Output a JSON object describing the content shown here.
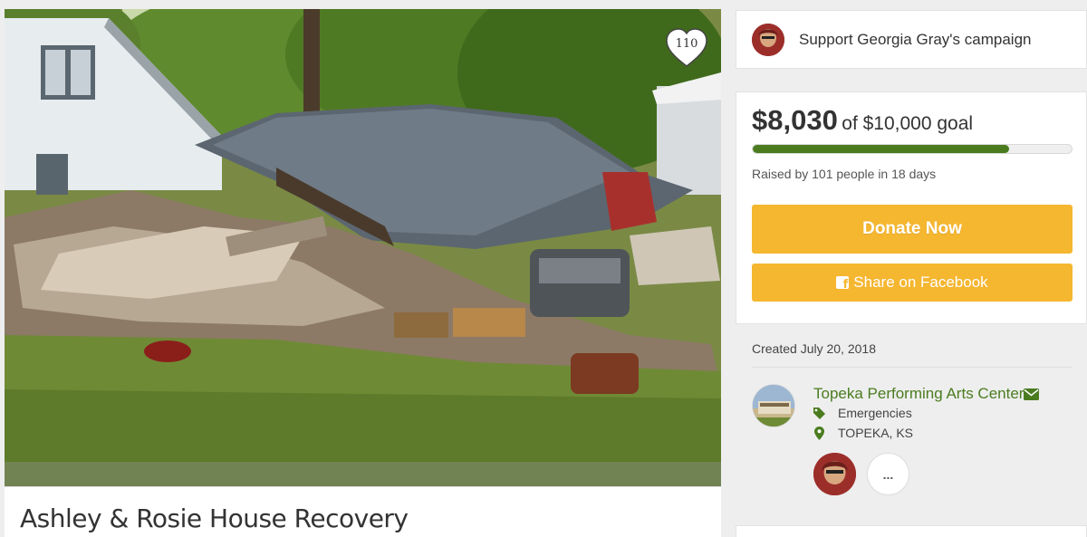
{
  "photo": {
    "alt_subject": "collapsed-house",
    "heart_count": "110"
  },
  "campaign": {
    "title": "Ashley & Rosie House Recovery"
  },
  "support": {
    "text": "Support Georgia Gray's campaign"
  },
  "donation": {
    "amount_raised": "$8,030",
    "goal_text": "of $10,000 goal",
    "progress_fraction": 0.803,
    "raised_by_text": "Raised by 101 people in 18 days",
    "donate_label": "Donate Now",
    "share_label": "Share on Facebook"
  },
  "details": {
    "created_text": "Created July 20, 2018",
    "organizer_name": "Topeka Performing Arts Center",
    "category": "Emergencies",
    "location": "TOPEKA, KS",
    "more_label": "..."
  },
  "icons": {
    "heart": "heart-icon",
    "facebook": "facebook-icon",
    "envelope": "envelope-icon",
    "tag": "tag-icon",
    "location": "map-pin-icon"
  },
  "colors": {
    "accent_green": "#4a7c1f",
    "button_orange": "#f5b630"
  }
}
